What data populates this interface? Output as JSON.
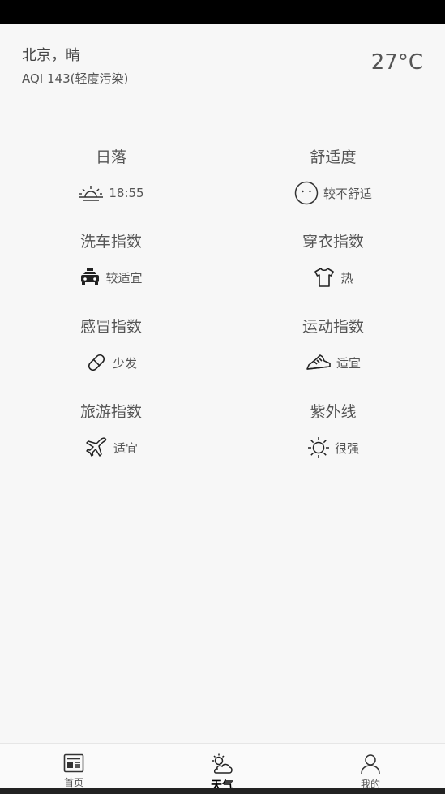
{
  "header": {
    "city_weather": "北京，晴",
    "aqi": "AQI 143(轻度污染)",
    "temperature": "27°C"
  },
  "indices": [
    {
      "title": "日落",
      "value": "18:55",
      "icon": "sunset-icon"
    },
    {
      "title": "舒适度",
      "value": "较不舒适",
      "icon": "face-icon"
    },
    {
      "title": "洗车指数",
      "value": "较适宜",
      "icon": "car-icon"
    },
    {
      "title": "穿衣指数",
      "value": "热",
      "icon": "tshirt-icon"
    },
    {
      "title": "感冒指数",
      "value": "少发",
      "icon": "pill-icon"
    },
    {
      "title": "运动指数",
      "value": "适宜",
      "icon": "sneaker-icon"
    },
    {
      "title": "旅游指数",
      "value": "适宜",
      "icon": "airplane-icon"
    },
    {
      "title": "紫外线",
      "value": "很强",
      "icon": "sun-icon"
    }
  ],
  "tabs": [
    {
      "label": "首页",
      "icon": "news-icon",
      "active": false
    },
    {
      "label": "天气",
      "icon": "weather-icon",
      "active": true
    },
    {
      "label": "我的",
      "icon": "user-icon",
      "active": false
    }
  ]
}
